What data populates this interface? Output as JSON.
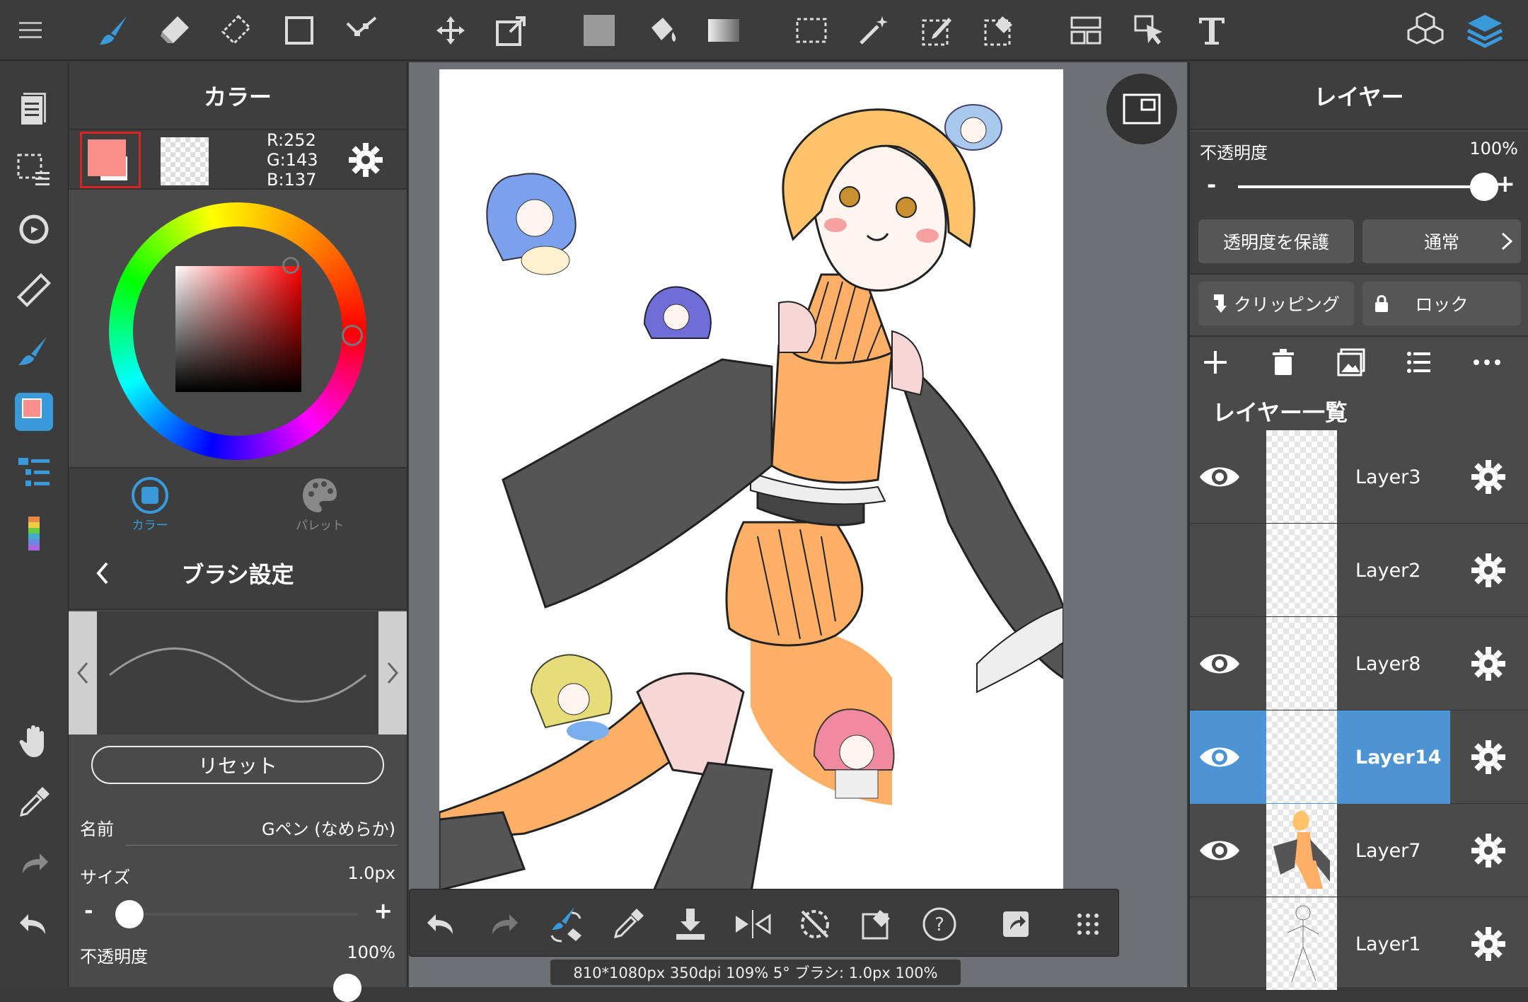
{
  "color_panel": {
    "title": "カラー",
    "rgb": {
      "r": "R:252",
      "g": "G:143",
      "b": "B:137"
    },
    "current_color": "#fc8f89",
    "tabs": [
      {
        "label": "カラー"
      },
      {
        "label": "パレット"
      }
    ]
  },
  "brush_panel": {
    "title": "ブラシ設定",
    "reset_label": "リセット",
    "name_label": "名前",
    "name_value": "Gペン (なめらか)",
    "size_label": "サイズ",
    "size_value": "1.0px",
    "size_minus": "-",
    "size_plus": "+",
    "opacity_label": "不透明度",
    "opacity_value": "100%"
  },
  "layer_panel": {
    "title": "レイヤー",
    "opacity_label": "不透明度",
    "opacity_value": "100%",
    "opacity_minus": "-",
    "opacity_plus": "+",
    "protect_alpha_label": "透明度を保護",
    "blend_mode_label": "通常",
    "clipping_label": "クリッピング",
    "lock_label": "ロック",
    "list_title": "レイヤー一覧",
    "layers": [
      {
        "name": "Layer3",
        "visible": true,
        "selected": false
      },
      {
        "name": "Layer2",
        "visible": false,
        "selected": false
      },
      {
        "name": "Layer8",
        "visible": true,
        "selected": false
      },
      {
        "name": "Layer14",
        "visible": true,
        "selected": true
      },
      {
        "name": "Layer7",
        "visible": true,
        "selected": false
      },
      {
        "name": "Layer1",
        "visible": false,
        "selected": false
      }
    ]
  },
  "status_bar": {
    "text": "810*1080px 350dpi 109% 5° ブラシ: 1.0px 100%"
  },
  "colors": {
    "accent": "#3a9ad9",
    "selected_layer": "#4d94d4",
    "panel_bg": "#4a4a4a",
    "canvas_bg": "#6d7075"
  }
}
